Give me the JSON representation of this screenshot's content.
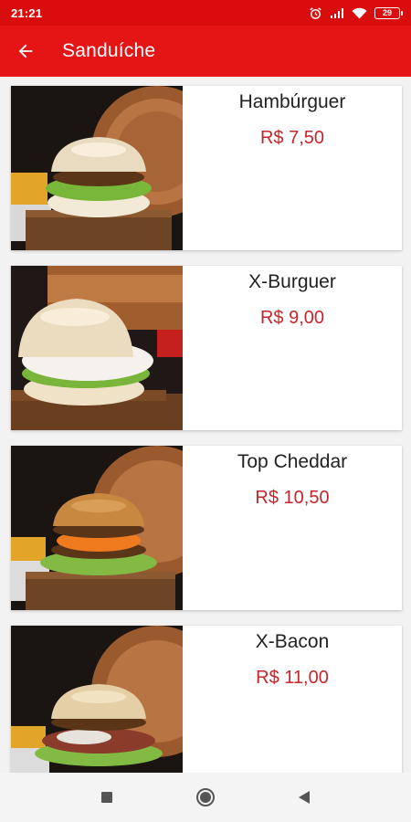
{
  "status_bar": {
    "time": "21:21",
    "battery_level": "29",
    "icons": [
      "alarm-icon",
      "signal-icon",
      "wifi-icon",
      "battery-icon"
    ]
  },
  "app_bar": {
    "title": "Sanduíche",
    "back_icon": "arrow-left-icon"
  },
  "products": [
    {
      "name": "Hambúrguer",
      "price": "R$ 7,50",
      "image": "hamburger-photo"
    },
    {
      "name": "X-Burguer",
      "price": "R$ 9,00",
      "image": "x-burger-photo"
    },
    {
      "name": "Top Cheddar",
      "price": "R$ 10,50",
      "image": "top-cheddar-photo"
    },
    {
      "name": "X-Bacon",
      "price": "R$ 11,00",
      "image": "x-bacon-photo"
    }
  ],
  "nav_bar": {
    "icons": [
      "recents-square-icon",
      "home-circle-icon",
      "back-triangle-icon"
    ]
  },
  "colors": {
    "status_bar": "#d90d0d",
    "app_bar": "#e51515",
    "price": "#c4262b",
    "background": "#f2f2f2"
  }
}
